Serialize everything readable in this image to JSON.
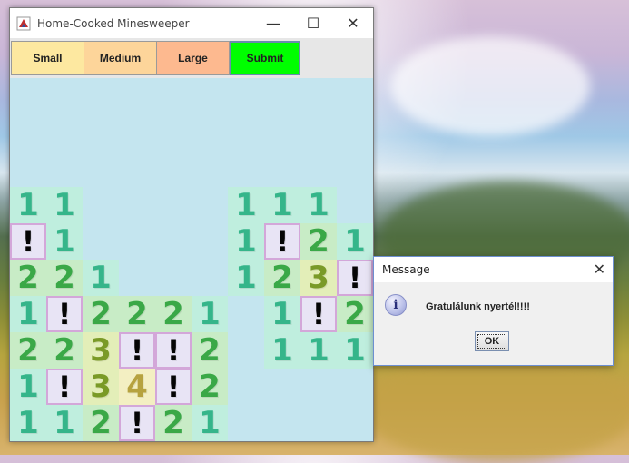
{
  "window": {
    "title": "Home-Cooked Minesweeper",
    "minimize_glyph": "—",
    "maximize_glyph": "☐",
    "close_glyph": "✕",
    "icon": "app-icon"
  },
  "toolbar": {
    "buttons": [
      {
        "label": "Small",
        "color": "#fde8a0"
      },
      {
        "label": "Medium",
        "color": "#fdd59a"
      },
      {
        "label": "Large",
        "color": "#fdb98f"
      },
      {
        "label": "Submit",
        "color": "#00ff00"
      }
    ]
  },
  "board": {
    "colors": {
      "1": "#35b58a",
      "2": "#3aa847",
      "3": "#7a9a27",
      "4": "#b6a23f",
      "flag_glyph": "!"
    },
    "rows": [
      "..........",
      "..........",
      "..........",
      "11....111.",
      "F1....1F21",
      "221...123F",
      "1F2221.1F2",
      "223FF2.111",
      "1F34F2....",
      "112F21...."
    ]
  },
  "dialog": {
    "title": "Message",
    "close_glyph": "✕",
    "message": "Gratulálunk nyertél!!!!",
    "ok_label": "OK",
    "icon_glyph": "i"
  }
}
